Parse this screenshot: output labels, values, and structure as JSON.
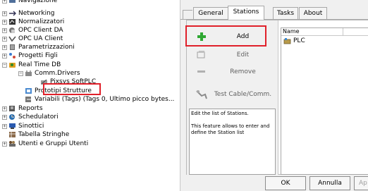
{
  "tree": {
    "items": [
      {
        "label": "Navigazione",
        "icon": "navigation-icon",
        "indent": 0,
        "expander": "+",
        "partial": true
      },
      {
        "label": "Networking",
        "icon": "networking-icon",
        "indent": 0,
        "expander": "+"
      },
      {
        "label": "Normalizzatori",
        "icon": "normalizer-icon",
        "indent": 0,
        "expander": "+"
      },
      {
        "label": "OPC Client DA",
        "icon": "opc-client-da-icon",
        "indent": 0,
        "expander": "+"
      },
      {
        "label": "OPC UA Client",
        "icon": "opc-ua-client-icon",
        "indent": 0,
        "expander": "+"
      },
      {
        "label": "Parametrizzazioni",
        "icon": "parameters-icon",
        "indent": 0,
        "expander": "+"
      },
      {
        "label": "Progetti Figli",
        "icon": "child-projects-icon",
        "indent": 0,
        "expander": "+"
      },
      {
        "label": "Real Time DB",
        "icon": "realtime-db-icon",
        "indent": 0,
        "expander": "−"
      },
      {
        "label": "Comm.Drivers",
        "icon": "comm-drivers-icon",
        "indent": 1,
        "expander": "−"
      },
      {
        "label": "Pixsys SoftPLC",
        "icon": "softplc-icon",
        "indent": 2,
        "expander": "",
        "link": true,
        "selected": true
      },
      {
        "label": "Prototipi Strutture",
        "icon": "prototypes-icon",
        "indent": 1,
        "expander": ""
      },
      {
        "label": "Variabili (Tags) (Tags 0, Ultimo picco bytes...",
        "icon": "variables-icon",
        "indent": 1,
        "expander": ""
      },
      {
        "label": "Reports",
        "icon": "reports-icon",
        "indent": 0,
        "expander": "+"
      },
      {
        "label": "Schedulatori",
        "icon": "schedulers-icon",
        "indent": 0,
        "expander": "+"
      },
      {
        "label": "Sinottici",
        "icon": "synoptics-icon",
        "indent": 0,
        "expander": "+"
      },
      {
        "label": "Tabella Stringhe",
        "icon": "string-table-icon",
        "indent": 0,
        "expander": ""
      },
      {
        "label": "Utenti e Gruppi Utenti",
        "icon": "users-groups-icon",
        "indent": 0,
        "expander": "+"
      }
    ]
  },
  "panel": {
    "tabs": [
      {
        "label": "General",
        "active": false
      },
      {
        "label": "Stations",
        "active": true
      },
      {
        "label": "Tasks",
        "active": false
      },
      {
        "label": "About",
        "active": false
      }
    ],
    "commands": [
      {
        "label": "Add",
        "icon": "add-plus-icon",
        "enabled": true
      },
      {
        "label": "Edit",
        "icon": "edit-icon",
        "enabled": false
      },
      {
        "label": "Remove",
        "icon": "remove-minus-icon",
        "enabled": false
      },
      {
        "label": "Test Cable/Comm.",
        "icon": "test-cable-icon",
        "enabled": false
      }
    ],
    "description": {
      "line1": "Edit the list of Stations.",
      "line2": "This feature allows to enter and define the Station list"
    },
    "list": {
      "columns": [
        "Name",
        ""
      ],
      "rows": [
        {
          "name": "PLC",
          "icon": "plc-station-icon"
        }
      ]
    },
    "footer": {
      "ok": "OK",
      "cancel": "Annulla",
      "apply": "Ap"
    }
  },
  "colors": {
    "highlight": "#e0202a",
    "accent": "#2a6fb0",
    "add_green": "#2fa833"
  }
}
